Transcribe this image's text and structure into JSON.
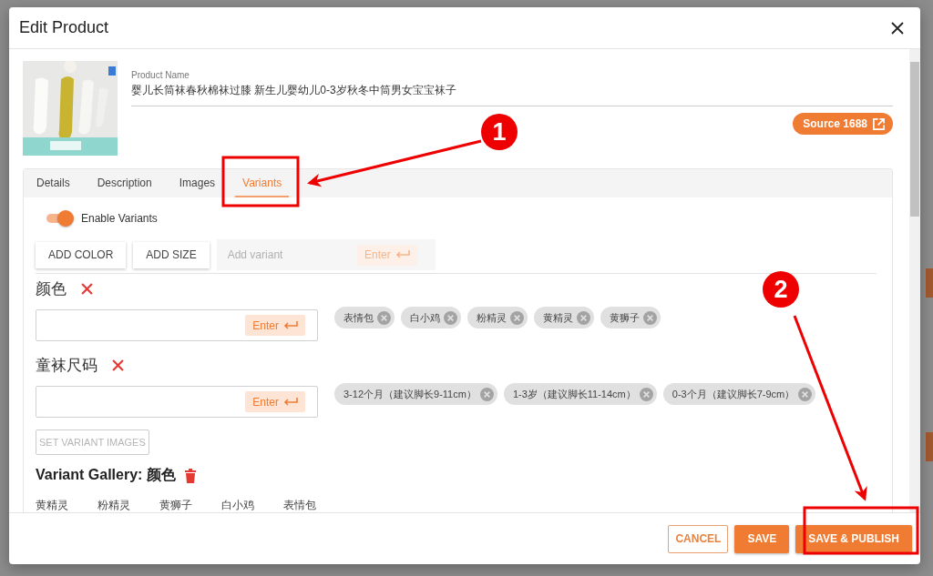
{
  "window": {
    "title": "Edit Product"
  },
  "product": {
    "name_label": "Product Name",
    "name_value": "婴儿长筒袜春秋棉袜过膝 新生儿婴幼儿0-3岁秋冬中筒男女宝宝袜子",
    "source_button": "Source 1688"
  },
  "tabs": [
    {
      "label": "Details",
      "selected": false
    },
    {
      "label": "Description",
      "selected": false
    },
    {
      "label": "Images",
      "selected": false
    },
    {
      "label": "Variants",
      "selected": true
    }
  ],
  "enable_variants": {
    "label": "Enable Variants",
    "on": true
  },
  "add_buttons": [
    "ADD COLOR",
    "ADD SIZE"
  ],
  "add_variant": {
    "placeholder": "Add variant",
    "enter_button": "Enter"
  },
  "variant_groups": [
    {
      "name": "颜色",
      "enter_button": "Enter",
      "values": [
        "表情包",
        "白小鸡",
        "粉精灵",
        "黄精灵",
        "黄狮子"
      ]
    },
    {
      "name": "童袜尺码",
      "enter_button": "Enter",
      "values": [
        "3-12个月（建议脚长9-11cm）",
        "1-3岁（建议脚长11-14cm）",
        "0-3个月（建议脚长7-9cm）"
      ]
    }
  ],
  "set_variant_images_button": {
    "label": "SET VARIANT IMAGES",
    "disabled": true
  },
  "gallery": {
    "title": "Variant Gallery: 颜色",
    "items": [
      "黄精灵",
      "粉精灵",
      "黄狮子",
      "白小鸡",
      "表情包"
    ]
  },
  "footer_buttons": [
    {
      "label": "CANCEL",
      "kind": "outlined"
    },
    {
      "label": "SAVE",
      "kind": "filled"
    },
    {
      "label": "SAVE & PUBLISH",
      "kind": "filled"
    }
  ],
  "annotations": [
    {
      "number": "1"
    },
    {
      "number": "2"
    }
  ]
}
